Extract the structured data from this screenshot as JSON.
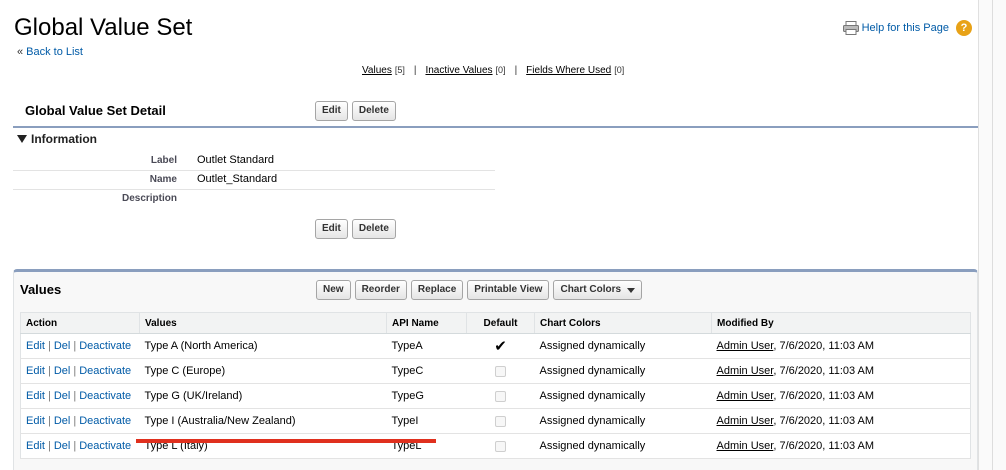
{
  "page": {
    "title": "Global Value Set",
    "back_link": "Back to List",
    "back_prefix": "«",
    "help_link": "Help for this Page",
    "help_symbol": "?"
  },
  "related_links": [
    {
      "label": "Values",
      "count": "[5]"
    },
    {
      "label": "Inactive Values",
      "count": "[0]"
    },
    {
      "label": "Fields Where Used",
      "count": "[0]"
    }
  ],
  "related_sep": "|",
  "detail": {
    "title": "Global Value Set Detail",
    "edit_label": "Edit",
    "delete_label": "Delete",
    "section_title": "Information",
    "fields": [
      {
        "label": "Label",
        "value": "Outlet Standard"
      },
      {
        "label": "Name",
        "value": "Outlet_Standard"
      },
      {
        "label": "Description",
        "value": ""
      }
    ]
  },
  "values_section": {
    "title": "Values",
    "buttons": {
      "new": "New",
      "reorder": "Reorder",
      "replace": "Replace",
      "printable_view": "Printable View",
      "chart_colors": "Chart Colors"
    },
    "columns": [
      "Action",
      "Values",
      "API Name",
      "Default",
      "Chart Colors",
      "Modified By"
    ],
    "action_links": {
      "edit": "Edit",
      "del": "Del",
      "deactivate": "Deactivate",
      "sep": "|"
    },
    "rows": [
      {
        "value": "Type A (North America)",
        "api_name": "TypeA",
        "default": true,
        "chart_color": "Assigned dynamically",
        "modified_user": "Admin User",
        "modified_date": ", 7/6/2020, 11:03 AM"
      },
      {
        "value": "Type C (Europe)",
        "api_name": "TypeC",
        "default": false,
        "chart_color": "Assigned dynamically",
        "modified_user": "Admin User",
        "modified_date": ", 7/6/2020, 11:03 AM"
      },
      {
        "value": "Type G (UK/Ireland)",
        "api_name": "TypeG",
        "default": false,
        "chart_color": "Assigned dynamically",
        "modified_user": "Admin User",
        "modified_date": ", 7/6/2020, 11:03 AM"
      },
      {
        "value": "Type I (Australia/New Zealand)",
        "api_name": "TypeI",
        "default": false,
        "chart_color": "Assigned dynamically",
        "modified_user": "Admin User",
        "modified_date": ", 7/6/2020, 11:03 AM"
      },
      {
        "value": "Type L (Italy)",
        "api_name": "TypeL",
        "default": false,
        "chart_color": "Assigned dynamically",
        "modified_user": "Admin User",
        "modified_date": ", 7/6/2020, 11:03 AM"
      }
    ]
  },
  "colors": {
    "link": "#015ba7",
    "section_border": "#8a9ebe",
    "annotation": "#e0301e",
    "help_icon": "#e8a217"
  },
  "icons": {
    "printer": "printer-icon",
    "help": "help-icon",
    "collapse": "triangle-down-icon",
    "dropdown": "caret-down-icon",
    "checked": "checkmark-icon"
  }
}
